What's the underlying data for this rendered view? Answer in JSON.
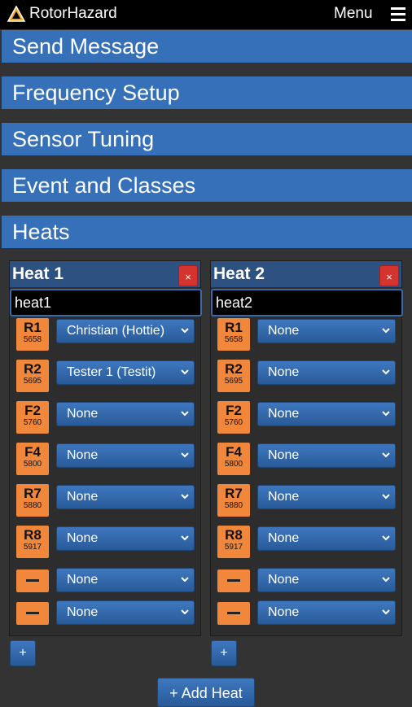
{
  "header": {
    "app_title": "RotorHazard",
    "menu_label": "Menu"
  },
  "sections": [
    "Send Message",
    "Frequency Setup",
    "Sensor Tuning",
    "Event and Classes",
    "Heats"
  ],
  "heats": [
    {
      "title": "Heat 1",
      "delete_label": "×",
      "name_value": "heat1",
      "slots": [
        {
          "band": "R1",
          "freq": "5658",
          "pilot": "Christian (Hottie)"
        },
        {
          "band": "R2",
          "freq": "5695",
          "pilot": "Tester 1 (Testit)"
        },
        {
          "band": "F2",
          "freq": "5760",
          "pilot": "None"
        },
        {
          "band": "F4",
          "freq": "5800",
          "pilot": "None"
        },
        {
          "band": "R7",
          "freq": "5880",
          "pilot": "None"
        },
        {
          "band": "R8",
          "freq": "5917",
          "pilot": "None"
        },
        {
          "band": "",
          "freq": "",
          "pilot": "None"
        },
        {
          "band": "",
          "freq": "",
          "pilot": "None"
        }
      ],
      "add_slot_label": "+"
    },
    {
      "title": "Heat 2",
      "delete_label": "×",
      "name_value": "heat2",
      "slots": [
        {
          "band": "R1",
          "freq": "5658",
          "pilot": "None"
        },
        {
          "band": "R2",
          "freq": "5695",
          "pilot": "None"
        },
        {
          "band": "F2",
          "freq": "5760",
          "pilot": "None"
        },
        {
          "band": "F4",
          "freq": "5800",
          "pilot": "None"
        },
        {
          "band": "R7",
          "freq": "5880",
          "pilot": "None"
        },
        {
          "band": "R8",
          "freq": "5917",
          "pilot": "None"
        },
        {
          "band": "",
          "freq": "",
          "pilot": "None"
        },
        {
          "band": "",
          "freq": "",
          "pilot": "None"
        }
      ],
      "add_slot_label": "+"
    }
  ],
  "add_heat_label": "+ Add Heat",
  "colors": {
    "section_blue": "#3570b9",
    "chip_orange": "#f0873a",
    "delete_red": "#d6332e"
  },
  "icons": {
    "logo": "rotorhazard-logo-icon",
    "menu": "hamburger-menu-icon",
    "select": "chevron-down-icon"
  }
}
